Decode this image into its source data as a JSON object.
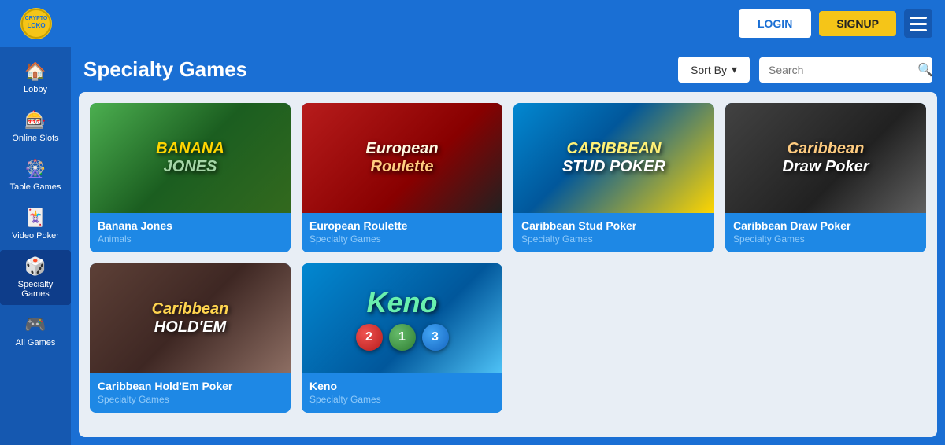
{
  "header": {
    "logo_text": "CRYPTO LOKO",
    "login_label": "LOGIN",
    "signup_label": "SIGNUP"
  },
  "sidebar": {
    "items": [
      {
        "id": "lobby",
        "label": "Lobby",
        "icon": "🏠",
        "active": false
      },
      {
        "id": "online-slots",
        "label": "Online Slots",
        "icon": "🎰",
        "active": false
      },
      {
        "id": "table-games",
        "label": "Table Games",
        "icon": "🎡",
        "active": false
      },
      {
        "id": "video-poker",
        "label": "Video Poker",
        "icon": "🃏",
        "active": false
      },
      {
        "id": "specialty-games",
        "label": "Specialty Games",
        "icon": "🎲",
        "active": true
      },
      {
        "id": "all-games",
        "label": "All Games",
        "icon": "🎮",
        "active": false
      }
    ]
  },
  "top_bar": {
    "page_title": "Specialty Games",
    "sort_label": "Sort By",
    "search_placeholder": "Search"
  },
  "games": [
    {
      "id": "banana-jones",
      "name": "Banana Jones",
      "category": "Animals",
      "thumb_class": "thumb-banana",
      "thumb_label": "BANANA JONES"
    },
    {
      "id": "european-roulette",
      "name": "European Roulette",
      "category": "Specialty Games",
      "thumb_class": "thumb-european",
      "thumb_label": "European Roulette"
    },
    {
      "id": "caribbean-stud-poker",
      "name": "Caribbean Stud Poker",
      "category": "Specialty Games",
      "thumb_class": "thumb-caribbean-stud",
      "thumb_label": "CARIBBEAN STUD POKER"
    },
    {
      "id": "caribbean-draw-poker",
      "name": "Caribbean Draw Poker",
      "category": "Specialty Games",
      "thumb_class": "thumb-caribbean-draw",
      "thumb_label": "Caribbean Draw Poker"
    },
    {
      "id": "caribbean-holdem",
      "name": "Caribbean Hold'Em Poker",
      "category": "Specialty Games",
      "thumb_class": "thumb-hold",
      "thumb_label": "Caribbean HOLD'EM"
    },
    {
      "id": "keno",
      "name": "Keno",
      "category": "Specialty Games",
      "thumb_class": "thumb-keno",
      "thumb_label": "Keno"
    }
  ]
}
